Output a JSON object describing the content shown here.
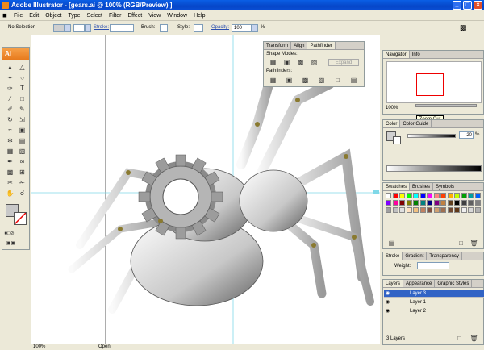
{
  "window": {
    "title": "Adobe Illustrator - [gears.ai @ 100% (RGB/Preview) ]",
    "min": "_",
    "max": "□",
    "close": "×"
  },
  "menu": [
    "File",
    "Edit",
    "Object",
    "Type",
    "Select",
    "Filter",
    "Effect",
    "View",
    "Window",
    "Help"
  ],
  "control": {
    "selection": "No Selection",
    "stroke": "Stroke:",
    "brush": "Brush:",
    "style": "Style:",
    "opacity": "Opacity:",
    "opacity_value": "100",
    "percent": "%"
  },
  "toolbox": {
    "header": "Ai"
  },
  "ruler": [
    "144",
    "180",
    "216",
    "252",
    "288",
    "324",
    "360",
    "396",
    "432",
    "468",
    "504",
    "540",
    "576",
    "612"
  ],
  "status": {
    "zoom": "100%",
    "text": "Open"
  },
  "pathfinder": {
    "tabs": [
      "Transform",
      "Align",
      "Pathfinder"
    ],
    "shape_modes": "Shape Modes:",
    "expand": "Expand",
    "pathfinders": "Pathfinders:"
  },
  "navigator": {
    "tabs": [
      "Navigator",
      "Info"
    ],
    "zoom": "100%",
    "tooltip": "Zoom Out"
  },
  "color": {
    "tabs": [
      "Color",
      "Color Guide"
    ],
    "value": "20",
    "percent": "%"
  },
  "swatches": {
    "tabs": [
      "Swatches",
      "Brushes",
      "Symbols"
    ],
    "colors": [
      "#ffffff",
      "#ff0000",
      "#ffff00",
      "#00ff00",
      "#00ffff",
      "#0000ff",
      "#ff00ff",
      "#ff8080",
      "#ff4000",
      "#ffb000",
      "#c0ff00",
      "#00a000",
      "#00a0a0",
      "#0060ff",
      "#8000ff",
      "#ff00a0",
      "#800000",
      "#808000",
      "#008000",
      "#008080",
      "#000080",
      "#800080",
      "#c08040",
      "#604020",
      "#000000",
      "#404040",
      "#606060",
      "#808080",
      "#a0a0a0",
      "#c0c0c0",
      "#e0e0e0",
      "#ffe0c0",
      "#f0c080",
      "#c08060",
      "#805040",
      "#d0a070",
      "#a07050",
      "#704830",
      "#603818",
      "#f0f0f0",
      "#d8d8d8",
      "#b0b0b0"
    ]
  },
  "stroke": {
    "tabs": [
      "Stroke",
      "Gradient",
      "Transparency"
    ],
    "weight": "Weight:"
  },
  "layers": {
    "tabs": [
      "Layers",
      "Appearance",
      "Graphic Styles"
    ],
    "rows": [
      "Layer 3",
      "Layer 1",
      "Layer 2"
    ],
    "footer": "3 Layers"
  }
}
